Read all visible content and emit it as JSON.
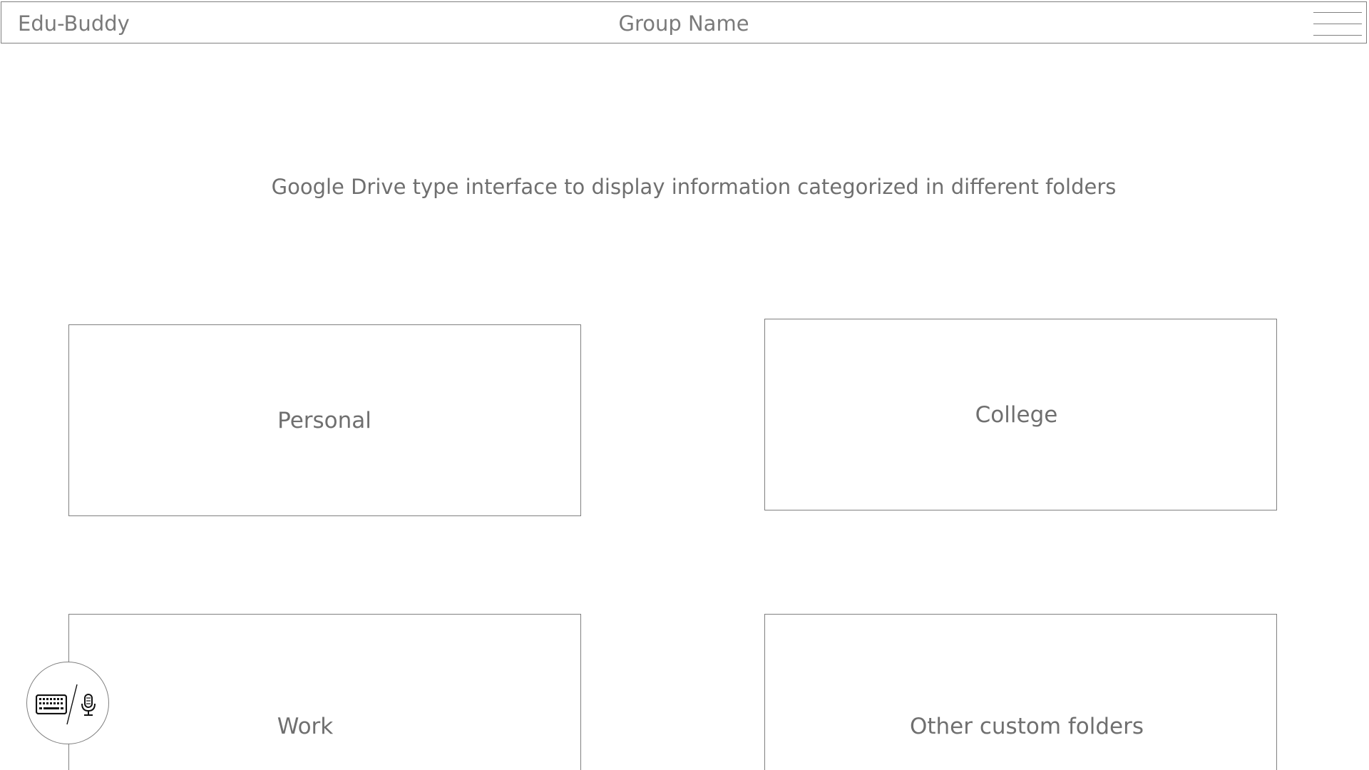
{
  "header": {
    "app_title": "Edu-Buddy",
    "group_name": "Group Name",
    "menu_icon": "hamburger-menu-icon"
  },
  "main": {
    "description": "Google Drive type interface to display information categorized in different folders",
    "folders": [
      {
        "label": "Personal"
      },
      {
        "label": "College"
      },
      {
        "label": "Work"
      },
      {
        "label": "Other custom folders"
      }
    ]
  },
  "input_mode": {
    "icons": [
      "keyboard-icon",
      "microphone-icon"
    ]
  },
  "colors": {
    "border": "#808080",
    "text": "#7a7a7a",
    "background": "#ffffff"
  }
}
